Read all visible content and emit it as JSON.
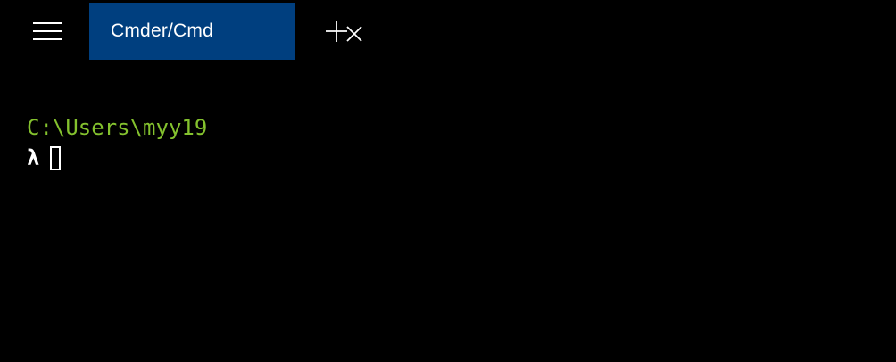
{
  "window": {
    "background": "#000000"
  },
  "titlebar": {
    "menu_icon": "hamburger-menu-icon",
    "tabs": [
      {
        "label": "Cmder/Cmd",
        "active": true,
        "color": "#003f7f",
        "close_icon": "close-icon"
      }
    ],
    "new_tab_icon": "plus-icon"
  },
  "terminal": {
    "path": "C:\\Users\\myy19",
    "path_color": "#84c22e",
    "prompt_symbol": "λ",
    "input_value": "",
    "text_color": "#ffffff"
  }
}
